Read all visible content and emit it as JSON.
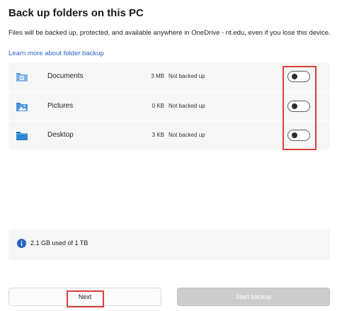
{
  "header": {
    "title": "Back up folders on this PC",
    "description": "Files will be backed up, protected, and available anywhere in OneDrive - rit.edu, even if you lose this device.",
    "learn_more": "Learn more about folder backup"
  },
  "folders": [
    {
      "name": "Documents",
      "size": "3 MB",
      "status": "Not backed up",
      "icon": "documents-folder-icon",
      "toggle_on": false
    },
    {
      "name": "Pictures",
      "size": "0 KB",
      "status": "Not backed up",
      "icon": "pictures-folder-icon",
      "toggle_on": false
    },
    {
      "name": "Desktop",
      "size": "3 KB",
      "status": "Not backed up",
      "icon": "desktop-folder-icon",
      "toggle_on": false
    }
  ],
  "storage": {
    "icon": "info-icon",
    "text": "2.1 GB used of 1 TB"
  },
  "buttons": {
    "next": "Next",
    "start_backup": "Start backup"
  },
  "colors": {
    "accent": "#2a63c6",
    "folder_blue": "#3b8fd8",
    "highlight": "#d9403a",
    "disabled_button": "#cccccc"
  }
}
